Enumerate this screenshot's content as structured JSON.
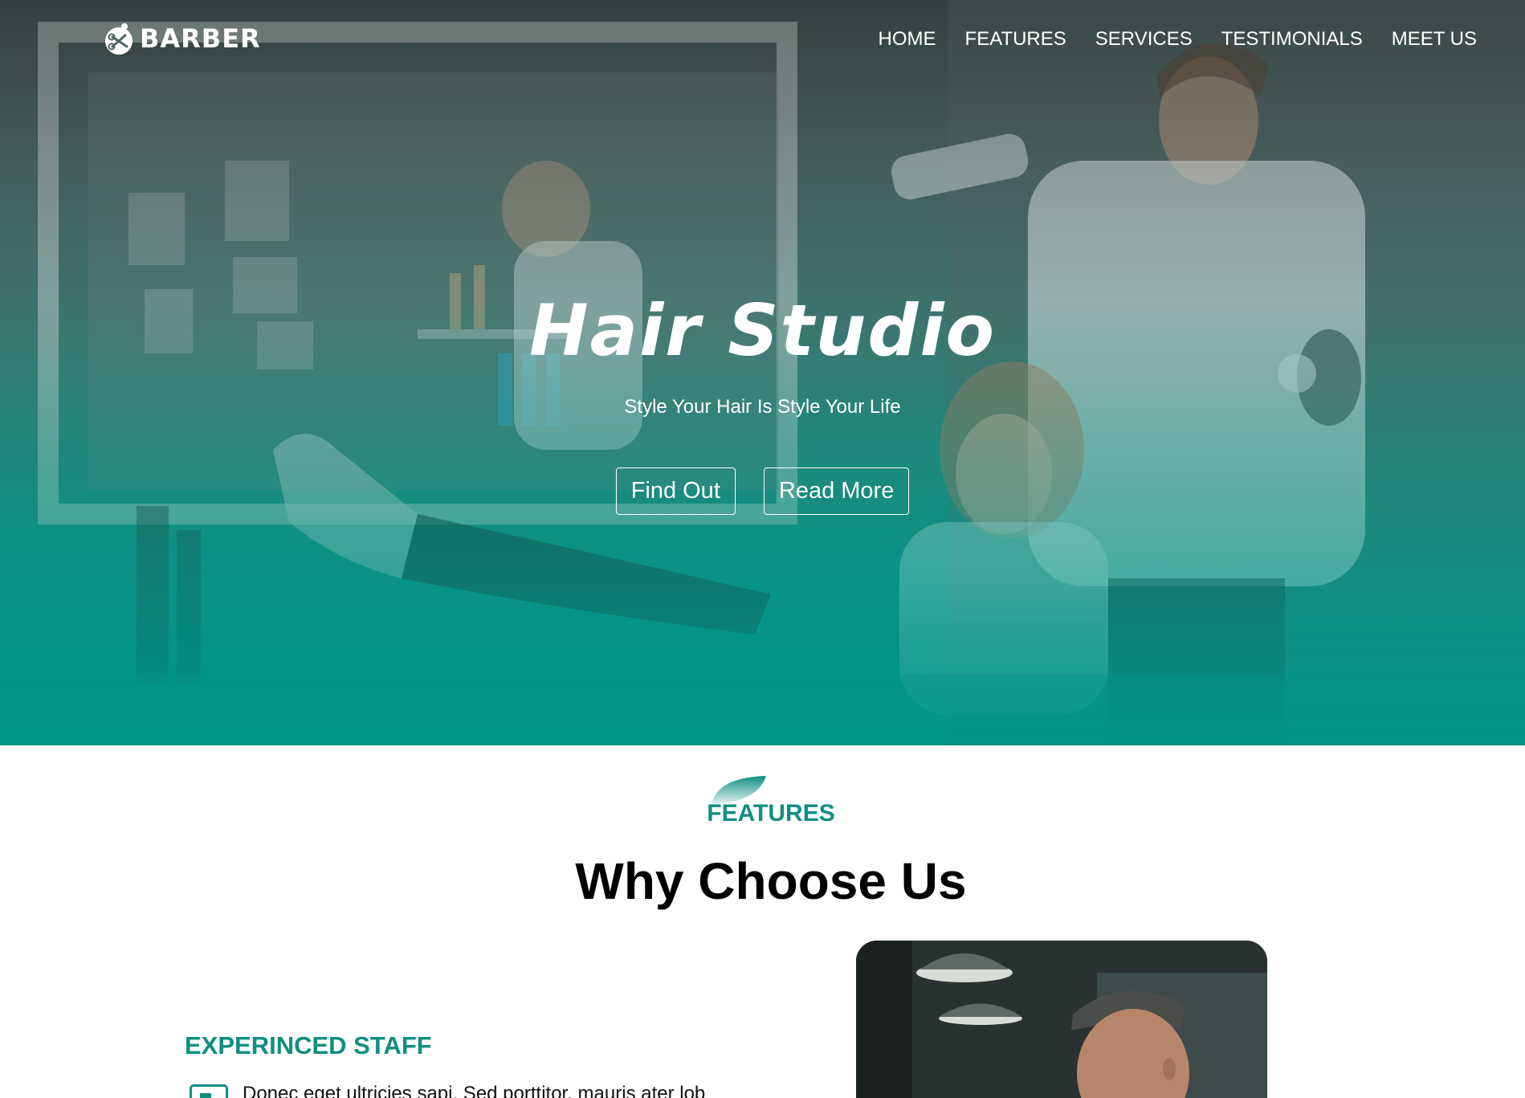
{
  "logo": {
    "text": "BARBER",
    "icon": "barber-scissors-icon"
  },
  "nav": {
    "items": [
      {
        "label": "HOME"
      },
      {
        "label": "FEATURES"
      },
      {
        "label": "SERVICES"
      },
      {
        "label": "TESTIMONIALS"
      },
      {
        "label": "MEET US"
      }
    ]
  },
  "hero": {
    "title": "Hair Studio",
    "subtitle": "Style Your Hair Is Style Your Life",
    "primary_button": "Find Out",
    "secondary_button": "Read More"
  },
  "features": {
    "label": "FEATURES",
    "title": "Why Choose Us",
    "items": [
      {
        "title": "EXPERINCED STAFF",
        "text": "Donec eget ultricies sapi. Sed porttitor, mauris ater lob",
        "icon": "staff-card-icon"
      }
    ]
  },
  "colors": {
    "accent": "#0f8f80",
    "hero_gradient_end": "#009688",
    "white": "#ffffff"
  }
}
